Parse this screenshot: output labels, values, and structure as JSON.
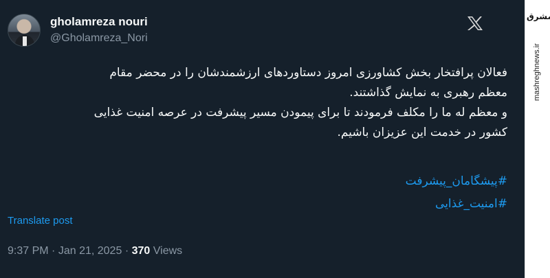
{
  "tweet": {
    "display_name": "gholamreza nouri",
    "handle": "@Gholamreza_Nori",
    "body_lines": [
      "فعالان پرافتخار بخش کشاورزی امروز دستاوردهای ارزشمندشان را در محضر مقام",
      "معظم رهبری به نمایش گذاشتند.",
      "و معظم له ما را مکلف فرمودند تا برای پیمودن مسیر پیشرفت در عرصه امنیت غذایی",
      "کشور در خدمت این عزیزان باشیم."
    ],
    "hashtags": [
      "#پیشگامان_پیشرفت",
      "#امنیت_غذایی"
    ],
    "translate_label": "Translate post",
    "time": "9:37 PM",
    "separator": "·",
    "date": "Jan 21, 2025",
    "views_count": "370",
    "views_label": "Views"
  },
  "watermark": {
    "logo_text": "مشرق",
    "url": "mashreghnews.ir"
  },
  "icons": {
    "avatar": "profile-photo",
    "x_logo": "x-logo-icon"
  },
  "colors": {
    "background": "#15202b",
    "link": "#1d9bf0",
    "text": "#f7f9f9",
    "muted": "#8b98a5"
  }
}
